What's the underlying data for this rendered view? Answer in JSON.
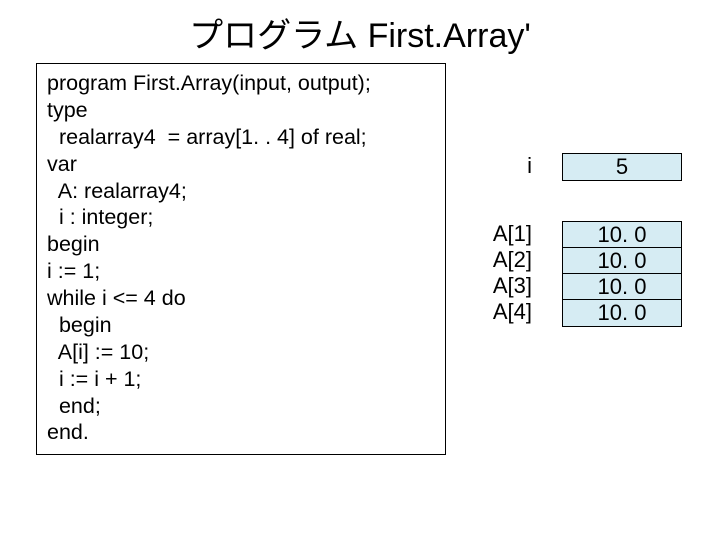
{
  "title": "プログラム First.Array'",
  "code": {
    "l1": "program First.Array(input, output);",
    "l2": "type",
    "l3": "  realarray4  = array[1. . 4] of real;",
    "l4": "var",
    "l5": "  A: realarray4;",
    "l6": "  i : integer;",
    "l7": "begin",
    "l8": "i := 1;",
    "l9": "while i <= 4 do",
    "l10": "  begin",
    "l11": "  A[i] := 10;",
    "l12": "  i := i + 1;",
    "l13": "  end;",
    "l14": "end."
  },
  "var_i": {
    "label": "i",
    "value": "5"
  },
  "var_A": {
    "labels": [
      "A[1]",
      "A[2]",
      "A[3]",
      "A[4]"
    ],
    "values": [
      "10. 0",
      "10. 0",
      "10. 0",
      "10. 0"
    ]
  }
}
